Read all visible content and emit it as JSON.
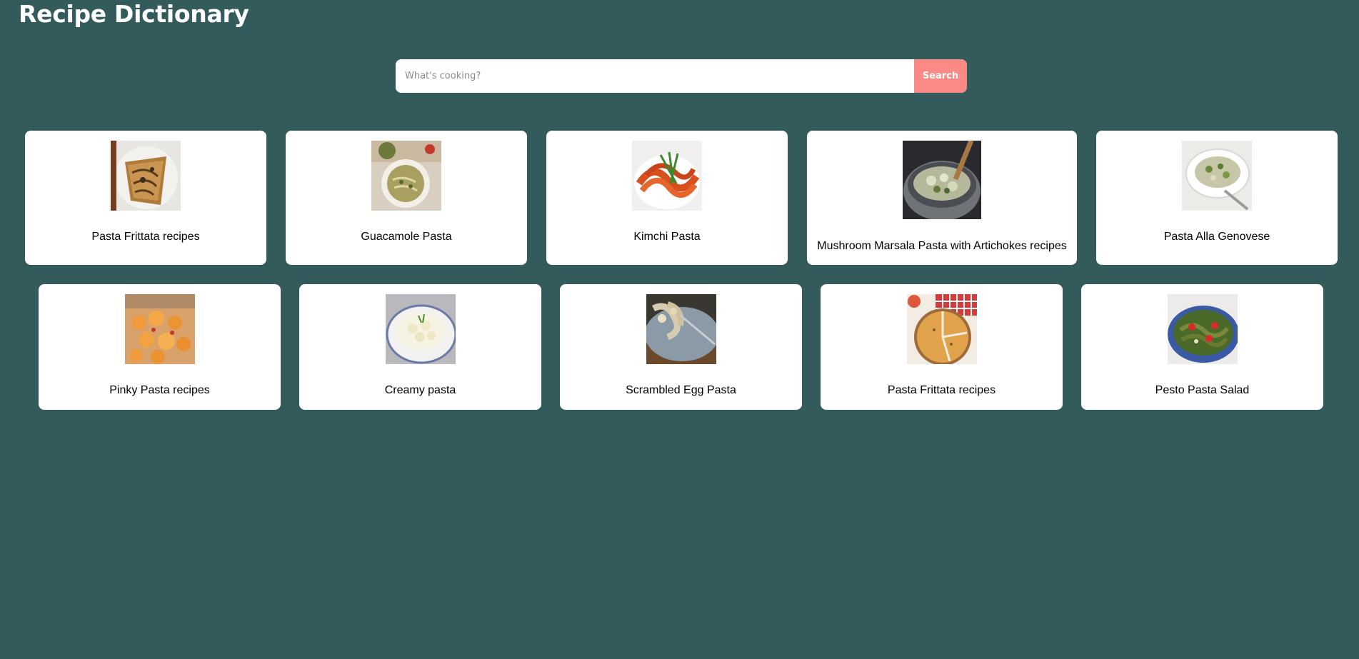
{
  "app": {
    "title": "Recipe Dictionary"
  },
  "search": {
    "placeholder": "What's cooking?",
    "value": "",
    "button_label": "Search"
  },
  "colors": {
    "background": "#345b5c",
    "search_button": "#fb8a86",
    "card": "#ffffff"
  },
  "recipes": [
    {
      "name": "Pasta Frittata recipes",
      "image_icon": "pasta-frittata-photo"
    },
    {
      "name": "Guacamole Pasta",
      "image_icon": "guacamole-pasta-photo"
    },
    {
      "name": "Kimchi Pasta",
      "image_icon": "kimchi-pasta-photo"
    },
    {
      "name": "Mushroom Marsala Pasta with Artichokes recipes",
      "image_icon": "mushroom-marsala-photo"
    },
    {
      "name": "Pasta Alla Genovese",
      "image_icon": "pasta-genovese-photo"
    },
    {
      "name": "Pinky Pasta recipes",
      "image_icon": "pinky-pasta-photo"
    },
    {
      "name": "Creamy pasta",
      "image_icon": "creamy-pasta-photo"
    },
    {
      "name": "Scrambled Egg Pasta",
      "image_icon": "scrambled-egg-pasta-photo"
    },
    {
      "name": "Pasta Frittata recipes",
      "image_icon": "pasta-frittata-photo"
    },
    {
      "name": "Pesto Pasta Salad",
      "image_icon": "pesto-pasta-salad-photo"
    }
  ]
}
